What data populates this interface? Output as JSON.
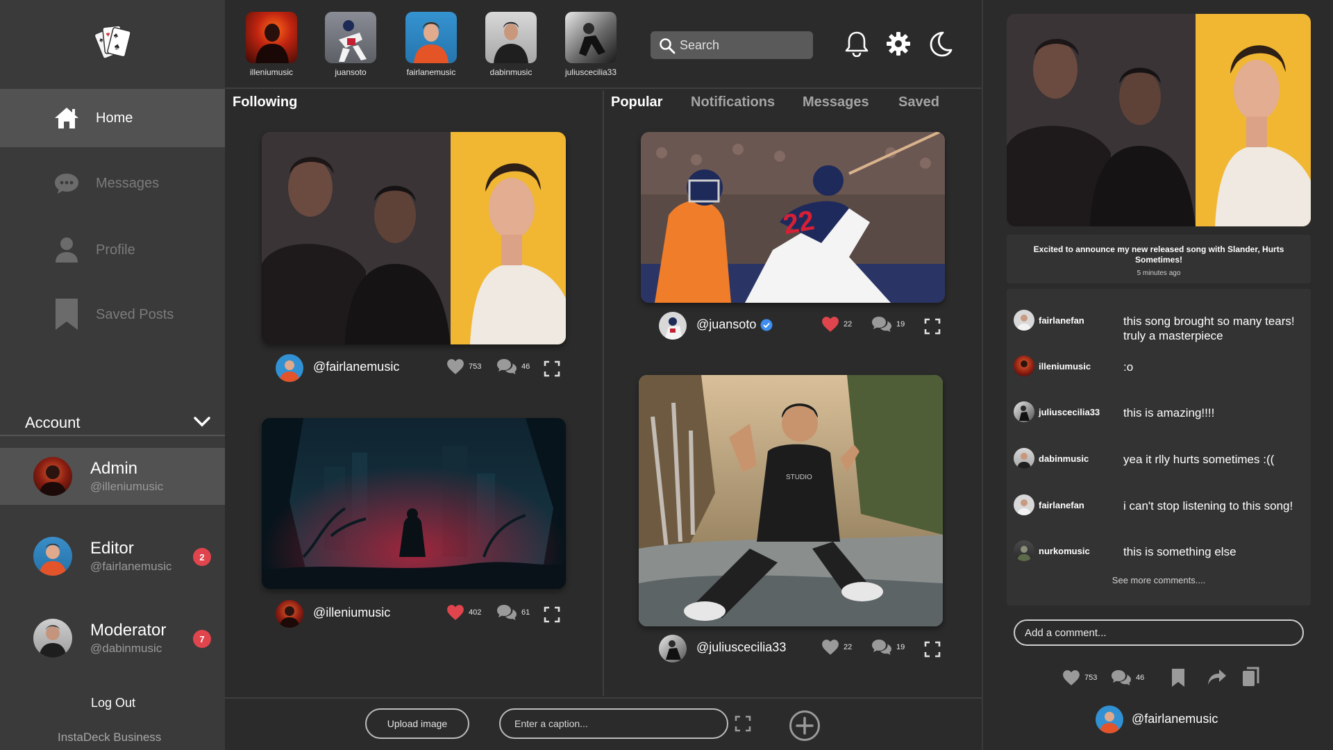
{
  "sidebar": {
    "nav": [
      {
        "label": "Home",
        "icon": "home-icon"
      },
      {
        "label": "Messages",
        "icon": "chat-bubble-icon"
      },
      {
        "label": "Profile",
        "icon": "person-icon"
      },
      {
        "label": "Saved Posts",
        "icon": "bookmark-icon"
      }
    ],
    "account_label": "Account",
    "roles": [
      {
        "role": "Admin",
        "handle": "@illeniumusic",
        "badge": ""
      },
      {
        "role": "Editor",
        "handle": "@fairlanemusic",
        "badge": "2"
      },
      {
        "role": "Moderator",
        "handle": "@dabinmusic",
        "badge": "7"
      }
    ],
    "logout": "Log Out",
    "business": "InstaDeck Business"
  },
  "stories": [
    "illeniumusic",
    "juansoto",
    "fairlanemusic",
    "dabinmusic",
    "juliuscecilia33"
  ],
  "search": {
    "placeholder": "Search"
  },
  "feed": {
    "following_title": "Following",
    "tabs": [
      "Popular",
      "Notifications",
      "Messages",
      "Saved"
    ],
    "following_posts": [
      {
        "handle": "@fairlanemusic",
        "likes": "753",
        "comments": "46",
        "liked": false
      },
      {
        "handle": "@illeniumusic",
        "likes": "402",
        "comments": "61",
        "liked": true
      }
    ],
    "popular_posts": [
      {
        "handle": "@juansoto",
        "likes": "22",
        "comments": "19",
        "liked": true,
        "verified": true
      },
      {
        "handle": "@juliuscecilia33",
        "likes": "22",
        "comments": "19",
        "liked": false
      }
    ]
  },
  "upload": {
    "button": "Upload image",
    "caption_placeholder": "Enter a caption..."
  },
  "detail": {
    "caption": "Excited to announce my new released song with Slander, Hurts Sometimes!",
    "time": "5 minutes ago",
    "comments": [
      {
        "user": "fairlanefan",
        "text": "this song brought so many tears! truly a masterpiece"
      },
      {
        "user": "illeniumusic",
        "text": ":o"
      },
      {
        "user": "juliuscecilia33",
        "text": "this is amazing!!!!"
      },
      {
        "user": "dabinmusic",
        "text": "yea it rlly hurts sometimes :(("
      },
      {
        "user": "fairlanefan",
        "text": "i can't stop listening to this song!"
      },
      {
        "user": "nurkomusic",
        "text": "this is something else"
      }
    ],
    "see_more": "See more comments....",
    "add_placeholder": "Add a comment...",
    "likes": "753",
    "comment_count": "46",
    "owner": "@fairlanemusic"
  },
  "colors": {
    "accent_red": "#e0454d",
    "verified_blue": "#3d8ef0",
    "sidebar_bg": "#3a3a3a",
    "main_bg": "#2b2b2b"
  }
}
